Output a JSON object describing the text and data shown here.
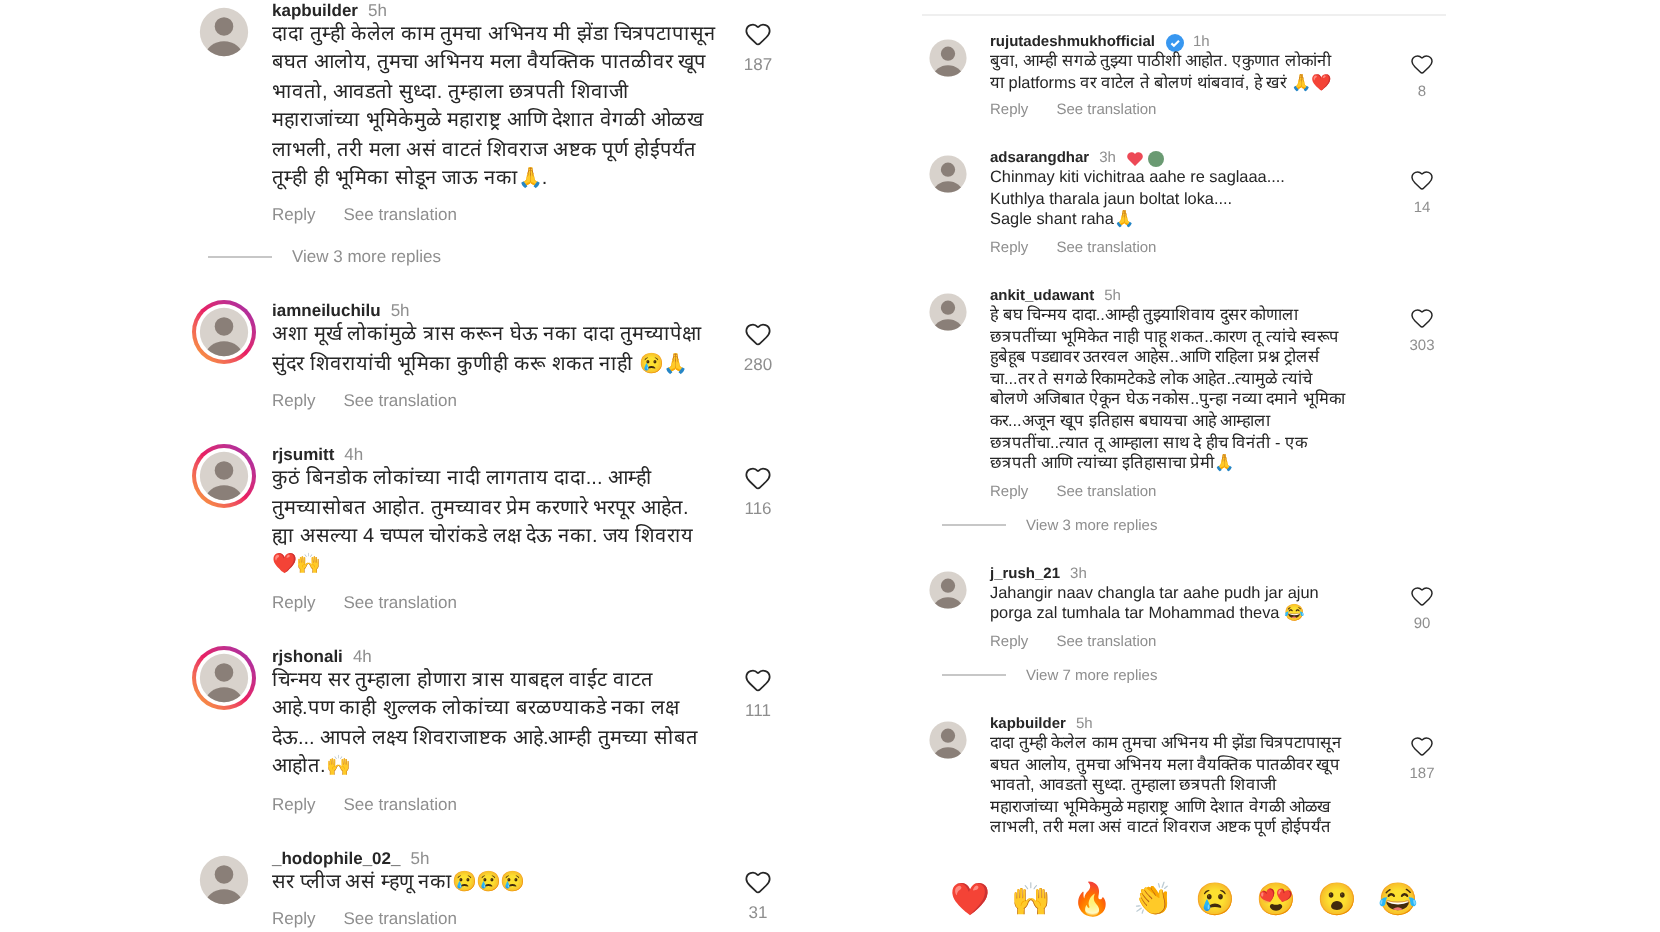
{
  "left_column": {
    "comments": [
      {
        "username": "kapbuilder",
        "time": "5h",
        "story_ring": false,
        "lines": [
          "दादा तुम्ही केलेल काम तुमचा अभिनय मी झेंडा चित्रपटापासून",
          "बघत आलोय, तुमचा अभिनय मला वैयक्तिक पातळीवर खूप",
          "भावतो, आवडतो सुध्दा. तुम्हाला छत्रपती शिवाजी",
          "महाराजांच्या भूमिकेमुळे महाराष्ट्र आणि देशात वेगळी ओळख",
          "लाभली, तरी मला असं वाटतं शिवराज अष्टक पूर्ण होईपर्यंत",
          "तूम्ही ही भूमिका सोडून जाऊ नका🙏."
        ],
        "likes": "187",
        "reply": "Reply",
        "translate": "See translation",
        "more_replies": "View 3 more replies"
      },
      {
        "username": "iamneiluchilu",
        "time": "5h",
        "story_ring": true,
        "lines": [
          "अशा मूर्ख लोकांमुळे त्रास करून घेऊ नका दादा तुमच्यापेक्षा",
          "सुंदर शिवरायांची भूमिका कुणीही करू शकत नाही 😢🙏"
        ],
        "likes": "280",
        "reply": "Reply",
        "translate": "See translation"
      },
      {
        "username": "rjsumitt",
        "time": "4h",
        "story_ring": true,
        "lines": [
          "कुठं बिनडोक लोकांच्या नादी लागताय दादा... आम्ही",
          "तुमच्यासोबत आहोत. तुमच्यावर प्रेम करणारे भरपूर आहेत.",
          "ह्या असल्या 4 चप्पल चोरांकडे लक्ष देऊ नका. जय शिवराय",
          "❤️🙌"
        ],
        "likes": "116",
        "reply": "Reply",
        "translate": "See translation"
      },
      {
        "username": "rjshonali",
        "time": "4h",
        "story_ring": true,
        "lines": [
          "चिन्मय सर तुम्हाला होणारा त्रास याबद्दल वाईट वाटत",
          "आहे.पण काही शुल्लक लोकांच्या बरळण्याकडे नका लक्ष",
          "देऊ... आपले लक्ष्य शिवराजाष्टक आहे.आम्ही तुमच्या सोबत",
          "आहोत.🙌"
        ],
        "likes": "111",
        "reply": "Reply",
        "translate": "See translation"
      },
      {
        "username": "_hodophile_02_",
        "time": "5h",
        "story_ring": false,
        "lines": [
          "सर प्लीज असं म्हणू नका😢😢😢"
        ],
        "likes": "31",
        "reply": "Reply",
        "translate": "See translation"
      }
    ]
  },
  "right_column": {
    "comments": [
      {
        "username": "rujutadeshmukhofficial",
        "time": "1h",
        "story_ring": false,
        "verified": true,
        "lines": [
          "बुवा, आम्ही सगळे तुझ्या पाठीशी आहोत. एकुणात लोकांनी",
          "या platforms वर वाटेल ते बोलणं थांबवावं, हे खरं 🙏❤️"
        ],
        "likes": "8",
        "reply": "Reply",
        "translate": "See translation"
      },
      {
        "username": "adsarangdhar",
        "time": "3h",
        "story_ring": false,
        "liked_by_author": true,
        "lines": [
          "Chinmay kiti vichitraa aahe re saglaaa....",
          "Kuthlya tharala jaun boltat loka....",
          "Sagle shant raha🙏"
        ],
        "likes": "14",
        "reply": "Reply",
        "translate": "See translation"
      },
      {
        "username": "ankit_udawant",
        "time": "5h",
        "story_ring": false,
        "lines": [
          "हे बघ चिन्मय दादा..आम्ही तुझ्याशिवाय दुसर कोणाला",
          "छत्रपतींच्या भूमिकेत नाही पाहू शकत..कारण तू त्यांचे स्वरूप",
          "हुबेहूब पडद्यावर उतरवल आहेस..आणि राहिला प्रश्न ट्रोलर्स",
          "चा...तर ते सगळे रिकामटेकडे लोक आहेत..त्यामुळे त्यांचे",
          "बोलणे अजिबात ऐकून घेऊ नकोस..पुन्हा नव्या दमाने भूमिका",
          "कर...अजून खूप इतिहास बघायचा आहे आम्हाला",
          "छत्रपतींचा..त्यात तू आम्हाला साथ दे हीच विनंती - एक",
          "छत्रपती आणि त्यांच्या इतिहासाचा प्रेमी🙏"
        ],
        "likes": "303",
        "reply": "Reply",
        "translate": "See translation",
        "more_replies": "View 3 more replies"
      },
      {
        "username": "j_rush_21",
        "time": "3h",
        "story_ring": false,
        "lines": [
          "Jahangir naav changla tar aahe pudh jar ajun",
          "porga zal tumhala tar Mohammad theva 😂"
        ],
        "likes": "90",
        "reply": "Reply",
        "translate": "See translation",
        "more_replies": "View 7 more replies"
      },
      {
        "username": "kapbuilder",
        "time": "5h",
        "story_ring": false,
        "lines": [
          "दादा तुम्ही केलेल काम तुमचा अभिनय मी झेंडा चित्रपटापासून",
          "बघत आलोय, तुमचा अभिनय मला वैयक्तिक पातळीवर खूप",
          "भावतो, आवडतो सुध्दा. तुम्हाला छत्रपती शिवाजी",
          "महाराजांच्या भूमिकेमुळे महाराष्ट्र आणि देशात वेगळी ओळख",
          "लाभली, तरी मला असं वाटतं शिवराज अष्टक पूर्ण होईपर्यंत"
        ],
        "likes": "187"
      }
    ],
    "emoji_reactions": [
      "❤️",
      "🙌",
      "🔥",
      "👏",
      "😢",
      "😍",
      "😮",
      "😂"
    ]
  }
}
